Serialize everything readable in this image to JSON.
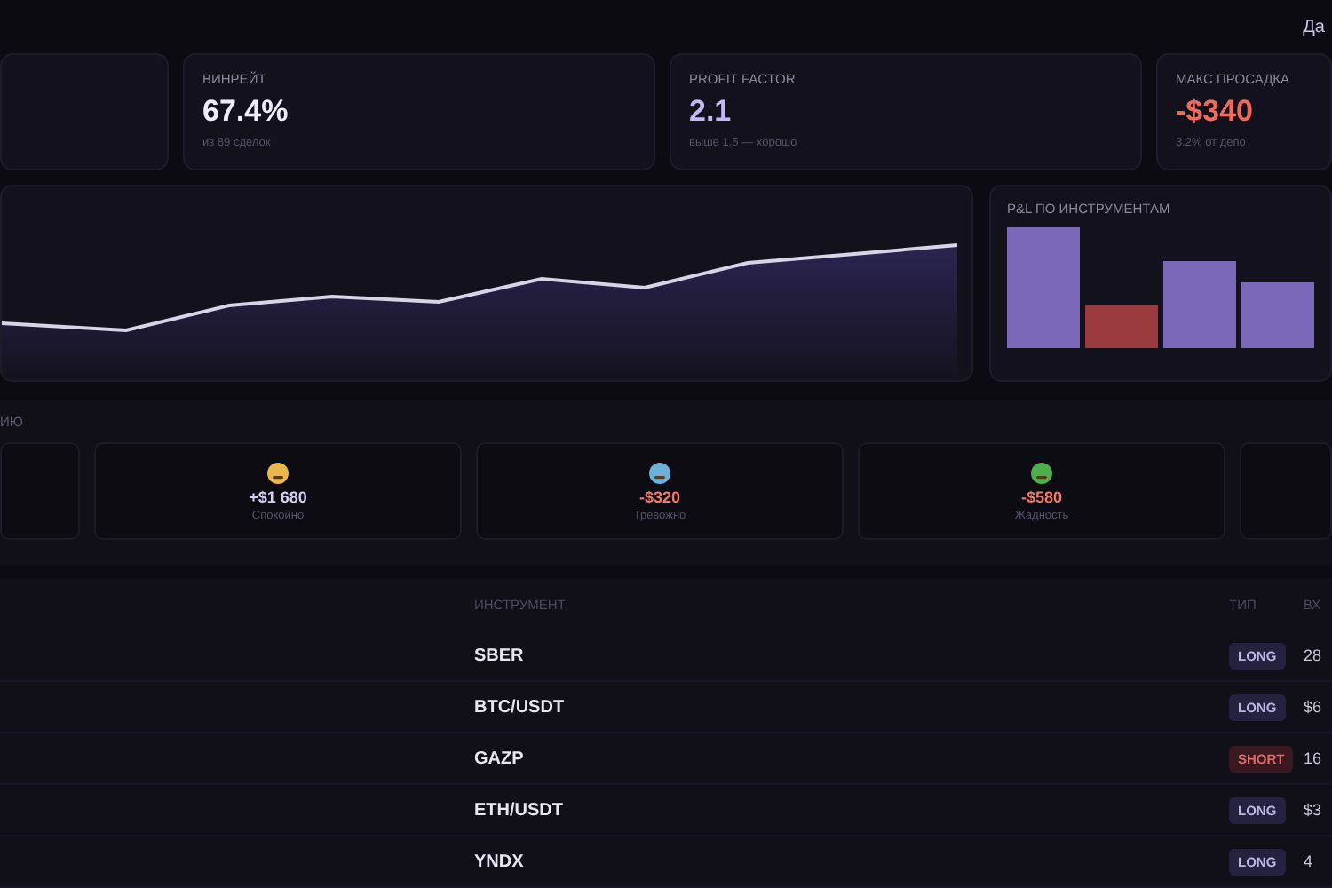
{
  "top_bar": {
    "link": "Да"
  },
  "stats": [
    {
      "kind": "empty"
    },
    {
      "kind": "stat",
      "label": "ВИНРЕЙТ",
      "value": "67.4%",
      "note": "из 89 сделок",
      "color": "#eeecf6"
    },
    {
      "kind": "stat",
      "label": "PROFIT FACTOR",
      "value": "2.1",
      "note": "выше 1.5 — хорошо",
      "color": "#c3b8f2"
    },
    {
      "kind": "stat",
      "label": "МАКС ПРОСАДКА",
      "value": "-$340",
      "note": "3.2% от депо",
      "color": "#f06b5e"
    }
  ],
  "instrument_pnl": {
    "title": "P&L ПО ИНСТРУМЕНТАМ",
    "bars": [
      {
        "color": "#7b68b8"
      },
      {
        "color": "#9b3a3f"
      },
      {
        "color": "#7b68b8"
      },
      {
        "color": "#7b68b8"
      }
    ]
  },
  "emotions": {
    "title": "ИЮ",
    "cards": [
      {
        "kind": "empty"
      },
      {
        "kind": "calm",
        "amount": "+$1 680",
        "label": "Спокойно",
        "color": "#d6d0f4"
      },
      {
        "kind": "anxious",
        "amount": "-$320",
        "label": "Тревожно",
        "color": "#f07a6a"
      },
      {
        "kind": "greed",
        "amount": "-$580",
        "label": "Жадность",
        "color": "#f07a6a"
      },
      {
        "kind": "empty"
      }
    ]
  },
  "trades": {
    "columns": [
      "ИНСТРУМЕНТ",
      "ТИП",
      "ВХ"
    ],
    "rows": [
      {
        "instrument": "SBER",
        "type": "LONG",
        "kind": "long",
        "entry": "28"
      },
      {
        "instrument": "BTC/USDT",
        "type": "LONG",
        "kind": "long",
        "entry": "$6"
      },
      {
        "instrument": "GAZP",
        "type": "SHORT",
        "kind": "short",
        "entry": "16"
      },
      {
        "instrument": "ETH/USDT",
        "type": "LONG",
        "kind": "long",
        "entry": "$3"
      },
      {
        "instrument": "YNDX",
        "type": "LONG",
        "kind": "long",
        "entry": "4"
      }
    ]
  }
}
